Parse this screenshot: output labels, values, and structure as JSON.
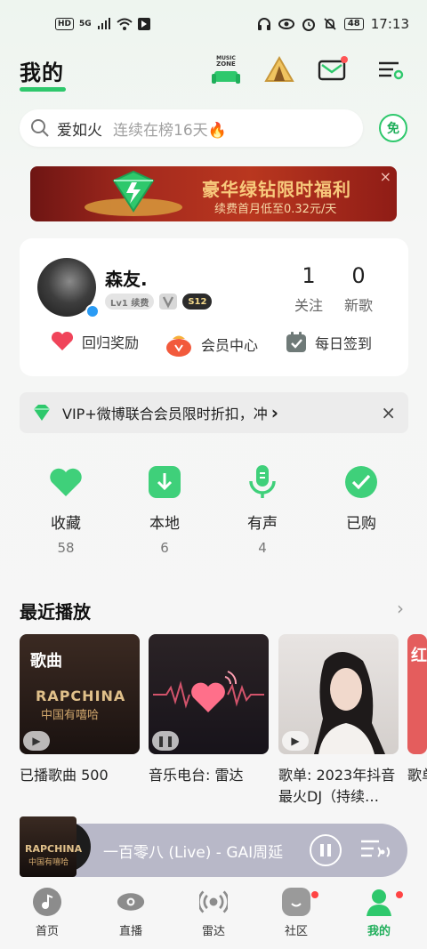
{
  "status_bar": {
    "left_chips": [
      "HD",
      "5G"
    ],
    "battery": "48",
    "time": "17:13"
  },
  "header": {
    "title": "我的",
    "music_zone_label": "MUSIC ZONE"
  },
  "search": {
    "query": "爱如火",
    "hint": "连续在榜16天🔥",
    "free_badge": "免"
  },
  "banner": {
    "title": "豪华绿钻限时福利",
    "subtitle": "续费首月低至0.32元/天",
    "close": "×"
  },
  "profile": {
    "nickname": "森友.",
    "level_badge": "Lv1 续费",
    "s_badge": "S12",
    "stats": [
      {
        "value": "1",
        "label": "关注"
      },
      {
        "value": "0",
        "label": "新歌"
      }
    ],
    "quick_actions": [
      "回归奖励",
      "会员中心",
      "每日签到"
    ]
  },
  "vip_strip": {
    "text": "VIP+微博联合会员限时折扣，冲",
    "arrow": "›",
    "close": "×"
  },
  "shortcuts": [
    {
      "label": "收藏",
      "count": "58",
      "icon": "heart-icon"
    },
    {
      "label": "本地",
      "count": "6",
      "icon": "download-icon"
    },
    {
      "label": "有声",
      "count": "4",
      "icon": "microphone-icon"
    },
    {
      "label": "已购",
      "count": "",
      "icon": "check-icon"
    }
  ],
  "recent": {
    "title": "最近播放",
    "arrow": "›",
    "items": [
      {
        "cover_text": "歌曲",
        "cover_sub": "RAPCHINA",
        "cover_sub2": "中国有嘻哈",
        "caption": "已播歌曲 500"
      },
      {
        "cover_text": "",
        "caption": "音乐电台: 雷达"
      },
      {
        "cover_text": "",
        "caption": "歌单: 2023年抖音最火DJ（持续…"
      },
      {
        "cover_text": "红",
        "caption": "歌单"
      }
    ]
  },
  "player": {
    "disc_text": "RAPCHINA",
    "disc_sub": "中国有嘻哈",
    "title": "一百零八 (Live) - GAI周延"
  },
  "bottom_nav": [
    {
      "label": "首页"
    },
    {
      "label": "直播"
    },
    {
      "label": "雷达"
    },
    {
      "label": "社区"
    },
    {
      "label": "我的"
    }
  ],
  "colors": {
    "accent": "#2ec86c",
    "banner_red": "#a52a1e",
    "player_bg": "#b8b8c8"
  }
}
